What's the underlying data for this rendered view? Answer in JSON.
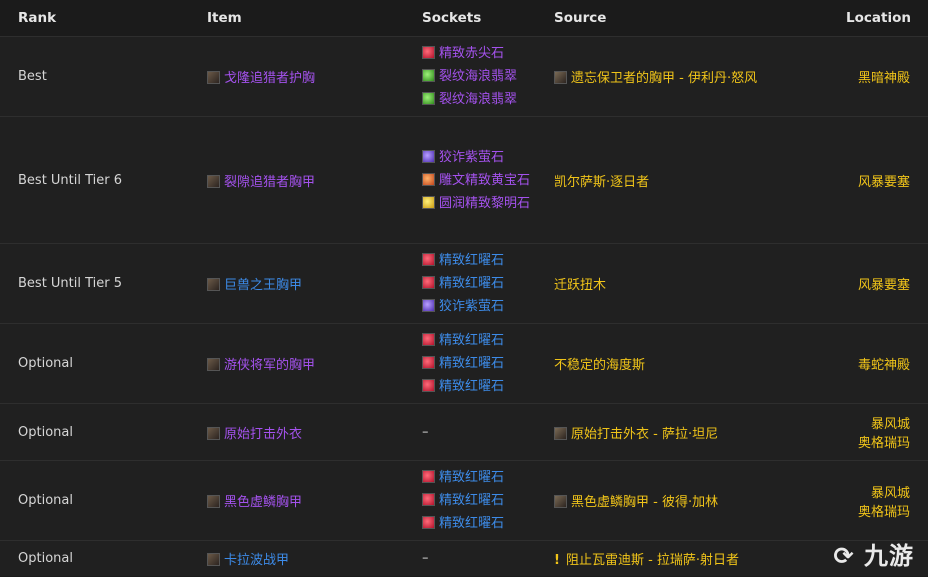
{
  "headers": {
    "rank": "Rank",
    "item": "Item",
    "sockets": "Sockets",
    "source": "Source",
    "location": "Location"
  },
  "rows": [
    {
      "rank": "Best",
      "item": "戈隆追猎者护胸",
      "item_color": "purple",
      "sockets": [
        "精致赤尖石",
        "裂纹海浪翡翠",
        "裂纹海浪翡翠"
      ],
      "source": "遗忘保卫者的胸甲 - 伊利丹·怒风",
      "location": "黑暗神殿"
    },
    {
      "rank": "Best Until Tier 6",
      "item": "裂隙追猎者胸甲",
      "item_color": "purple",
      "sockets": [
        "狡诈紫萤石",
        "雕文精致黄宝石",
        "圆润精致黎明石"
      ],
      "source": "凯尔萨斯·逐日者",
      "location": "风暴要塞"
    },
    {
      "rank": "Best Until Tier 5",
      "item": "巨兽之王胸甲",
      "item_color": "blue",
      "sockets": [
        "精致红曜石",
        "精致红曜石",
        "狡诈紫萤石"
      ],
      "source": "迁跃扭木",
      "location": "风暴要塞"
    },
    {
      "rank": "Optional",
      "item": "游侠将军的胸甲",
      "item_color": "purple",
      "sockets": [
        "精致红曜石",
        "精致红曜石",
        "精致红曜石"
      ],
      "source": "不稳定的海度斯",
      "location": "毒蛇神殿"
    },
    {
      "rank": "Optional",
      "item": "原始打击外衣",
      "item_color": "purple",
      "sockets": [
        "–"
      ],
      "source": "原始打击外衣 - 萨拉·坦尼",
      "location": "暴风城",
      "location2": "奥格瑞玛"
    },
    {
      "rank": "Optional",
      "item": "黑色虚鳞胸甲",
      "item_color": "purple",
      "sockets": [
        "精致红曜石",
        "精致红曜石",
        "精致红曜石"
      ],
      "source": "黑色虚鳞胸甲 - 彼得·加林",
      "location": "暴风城",
      "location2": "奥格瑞玛"
    },
    {
      "rank": "Optional",
      "item": "卡拉波战甲",
      "item_color": "blue",
      "sockets": [
        "–"
      ],
      "source": "阻止瓦雷迪斯 - 拉瑞萨·射日者",
      "location": ""
    }
  ],
  "watermark": "九游"
}
